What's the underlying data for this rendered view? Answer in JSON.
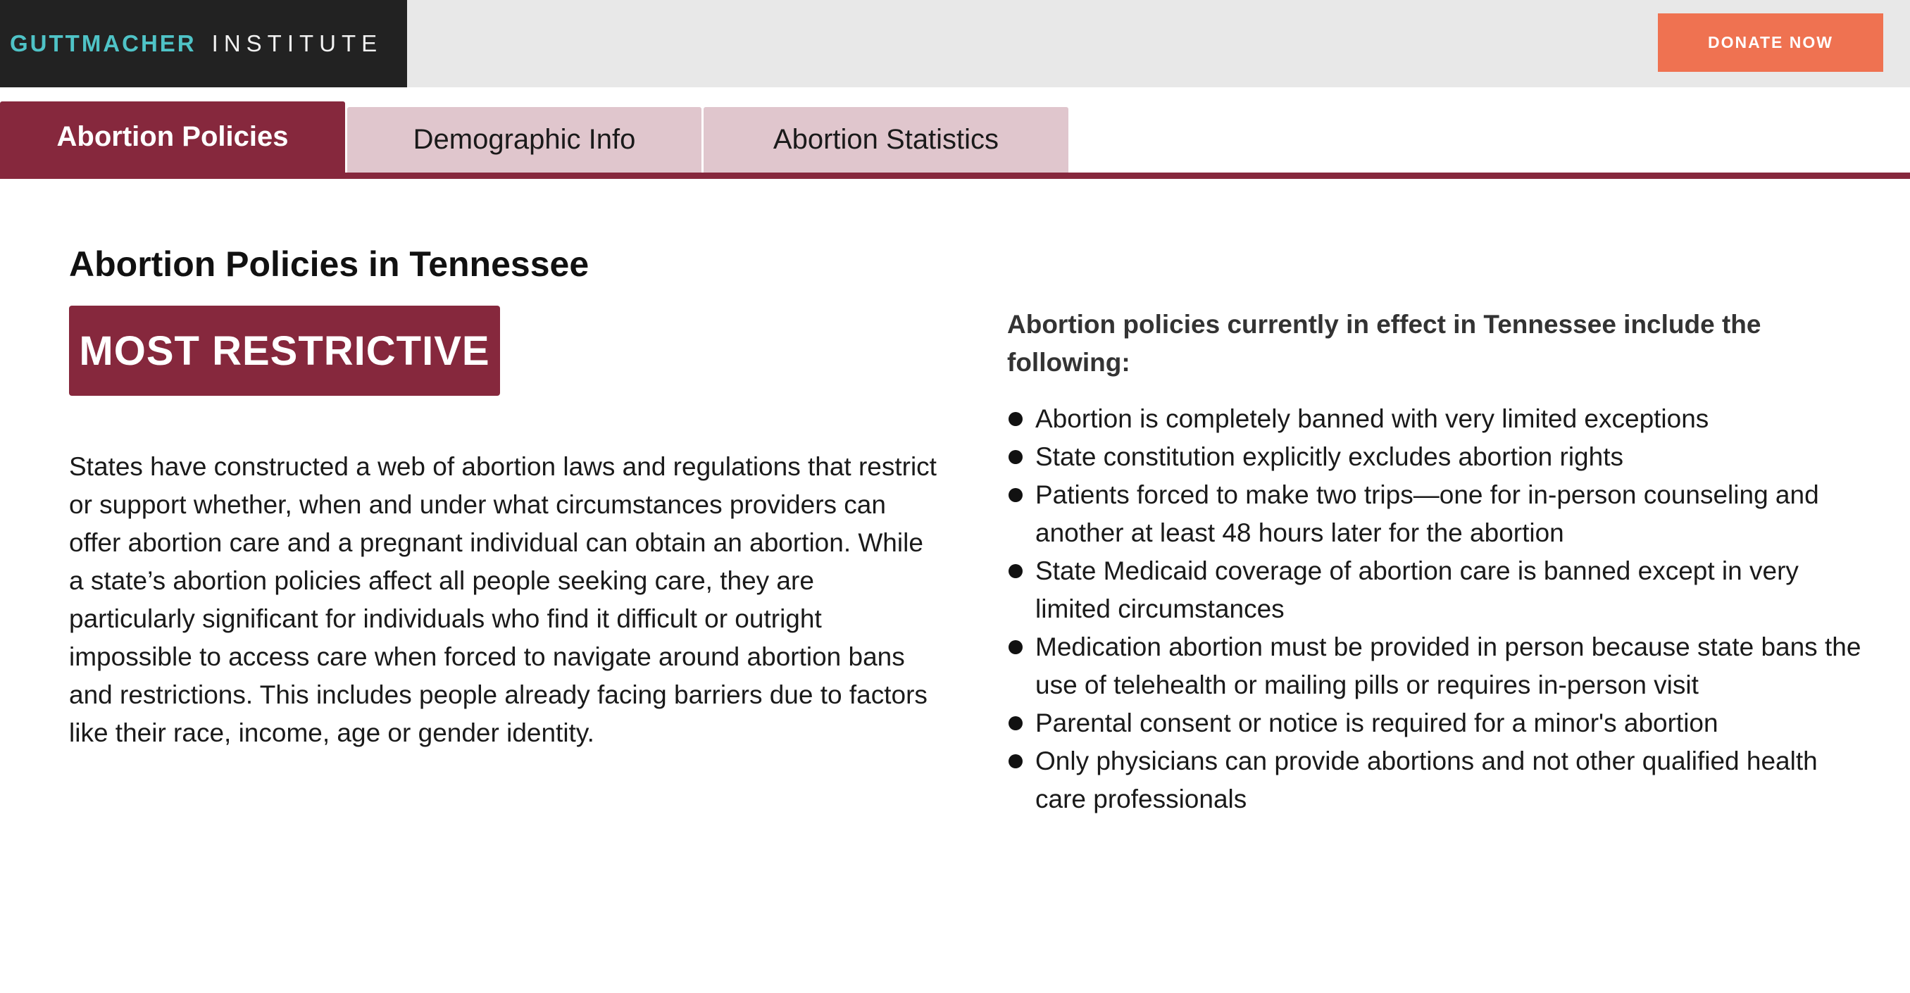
{
  "header": {
    "logo_part1": "GUTTMACHER",
    "logo_part2": "INSTITUTE",
    "donate_label": "DONATE NOW"
  },
  "tabs": [
    {
      "label": "Abortion Policies",
      "active": true
    },
    {
      "label": "Demographic Info",
      "active": false
    },
    {
      "label": "Abortion Statistics",
      "active": false
    }
  ],
  "main": {
    "title": "Abortion Policies in Tennessee",
    "badge": "MOST RESTRICTIVE",
    "intro": "States have constructed a web of abortion laws and regulations that restrict or support whether, when and under what circumstances providers can offer abortion care and a pregnant individual can obtain an abortion. While a state’s abortion policies affect all people seeking care, they are particularly significant for individuals who find it difficult or outright impossible to access care when forced to navigate around abortion bans and restrictions. This includes people already facing barriers due to factors like their race, income, age or gender identity."
  },
  "policies": {
    "heading": "Abortion policies currently in effect in Tennessee include the following:",
    "items": [
      "Abortion is completely banned with very limited exceptions",
      "State constitution explicitly excludes abortion rights",
      "Patients forced to make two trips—one for in-person counseling and another at least 48 hours later for the abortion",
      "State Medicaid coverage of abortion care is banned except in very limited circumstances",
      "Medication abortion must be provided in person because state bans the use of telehealth or mailing pills or requires in-person visit",
      "Parental consent or notice is required for a minor's abortion",
      "Only physicians can provide abortions and not other qualified health care professionals"
    ]
  },
  "colors": {
    "brand_maroon": "#86283d",
    "tab_inactive": "#e0c6cd",
    "donate_orange": "#ef7251",
    "logo_teal": "#4fc3c7",
    "logo_bg": "#222222",
    "header_bg": "#e8e8e8"
  }
}
